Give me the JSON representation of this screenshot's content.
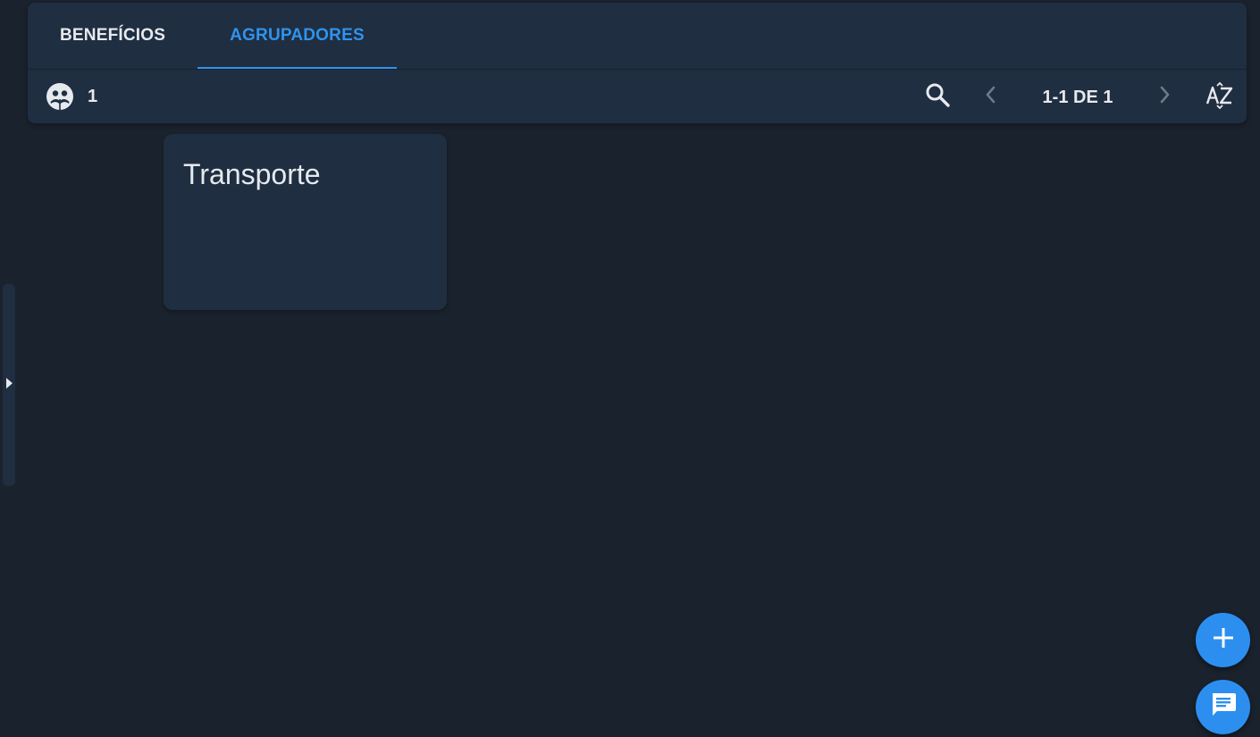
{
  "tabs": [
    {
      "label": "BENEFÍCIOS",
      "active": false
    },
    {
      "label": "AGRUPADORES",
      "active": true
    }
  ],
  "toolbar": {
    "count_icon": "group-icon",
    "count": "1",
    "pagination": "1-1 DE 1",
    "search_icon": "search-icon",
    "prev_icon": "chevron-left-icon",
    "next_icon": "chevron-right-icon",
    "sort_icon": "sort-az-icon"
  },
  "cards": [
    {
      "title": "Transporte"
    }
  ],
  "fabs": {
    "add_icon": "plus-icon",
    "chat_icon": "chat-icon"
  },
  "colors": {
    "background": "#1a222d",
    "panel": "#1f2e40",
    "accent": "#2f93ee",
    "fab": "#2c8ff0",
    "text": "#e6e9ee"
  }
}
